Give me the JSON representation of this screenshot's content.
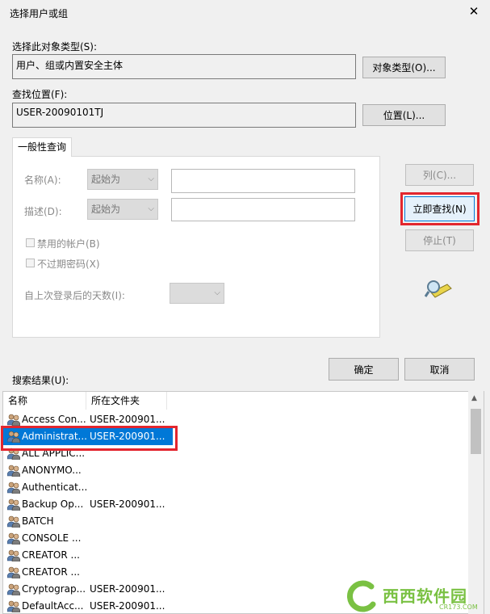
{
  "window": {
    "title": "选择用户或组",
    "close_glyph": "✕"
  },
  "object_type": {
    "label": "选择此对象类型(S):",
    "value": "用户、组或内置安全主体",
    "button": "对象类型(O)..."
  },
  "location": {
    "label": "查找位置(F):",
    "value": "USER-20090101TJ",
    "button": "位置(L)..."
  },
  "tab": {
    "label": "一般性查询"
  },
  "query": {
    "name_label": "名称(A):",
    "name_mode": "起始为",
    "desc_label": "描述(D):",
    "desc_mode": "起始为",
    "disabled_accounts": "禁用的帐户(B)",
    "no_expire_pw": "不过期密码(X)",
    "days_label": "自上次登录后的天数(I):",
    "dropdown_arrow": "⌵"
  },
  "buttons": {
    "columns": "列(C)...",
    "find_now": "立即查找(N)",
    "stop": "停止(T)",
    "ok": "确定",
    "cancel": "取消"
  },
  "results": {
    "label": "搜索结果(U):",
    "columns": [
      "名称",
      "所在文件夹"
    ],
    "rows": [
      {
        "name": "Access Con...",
        "folder": "USER-200901..."
      },
      {
        "name": "Administrat...",
        "folder": "USER-200901...",
        "selected": true
      },
      {
        "name": "ALL APPLIC...",
        "folder": ""
      },
      {
        "name": "ANONYMO...",
        "folder": ""
      },
      {
        "name": "Authenticat...",
        "folder": ""
      },
      {
        "name": "Backup Op...",
        "folder": "USER-200901..."
      },
      {
        "name": "BATCH",
        "folder": ""
      },
      {
        "name": "CONSOLE ...",
        "folder": ""
      },
      {
        "name": "CREATOR ...",
        "folder": ""
      },
      {
        "name": "CREATOR ...",
        "folder": ""
      },
      {
        "name": "Cryptograp...",
        "folder": "USER-200901..."
      },
      {
        "name": "DefaultAcc...",
        "folder": "USER-200901..."
      }
    ]
  },
  "watermark": {
    "text": "西西软件园",
    "sub": "CR173.COM"
  },
  "colors": {
    "accent": "#0078d7",
    "highlight": "#e3262e",
    "watermark": "#7ac143"
  }
}
